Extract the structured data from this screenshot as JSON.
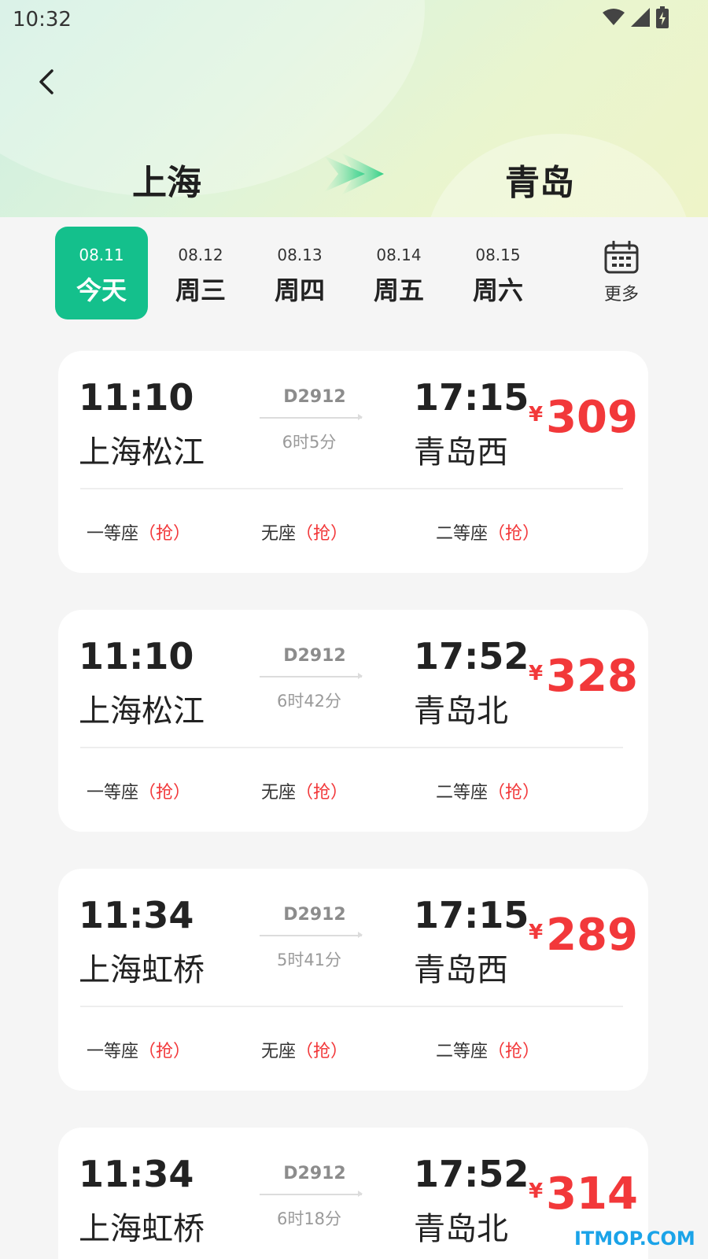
{
  "status_bar": {
    "time": "10:32"
  },
  "route": {
    "from": "上海",
    "to": "青岛"
  },
  "date_tabs": [
    {
      "date": "08.11",
      "weekday": "今天",
      "active": true
    },
    {
      "date": "08.12",
      "weekday": "周三",
      "active": false
    },
    {
      "date": "08.13",
      "weekday": "周四",
      "active": false
    },
    {
      "date": "08.14",
      "weekday": "周五",
      "active": false
    },
    {
      "date": "08.15",
      "weekday": "周六",
      "active": false
    }
  ],
  "more_label": "更多",
  "currency": "¥",
  "trains": [
    {
      "dep_time": "11:10",
      "dep_station": "上海松江",
      "train_no": "D2912",
      "duration": "6时5分",
      "arr_time": "17:15",
      "arr_station": "青岛西",
      "price": "309",
      "seats": [
        {
          "name": "一等座",
          "status": "（抢）"
        },
        {
          "name": "无座",
          "status": "（抢）"
        },
        {
          "name": "二等座",
          "status": "（抢）"
        }
      ]
    },
    {
      "dep_time": "11:10",
      "dep_station": "上海松江",
      "train_no": "D2912",
      "duration": "6时42分",
      "arr_time": "17:52",
      "arr_station": "青岛北",
      "price": "328",
      "seats": [
        {
          "name": "一等座",
          "status": "（抢）"
        },
        {
          "name": "无座",
          "status": "（抢）"
        },
        {
          "name": "二等座",
          "status": "（抢）"
        }
      ]
    },
    {
      "dep_time": "11:34",
      "dep_station": "上海虹桥",
      "train_no": "D2912",
      "duration": "5时41分",
      "arr_time": "17:15",
      "arr_station": "青岛西",
      "price": "289",
      "seats": [
        {
          "name": "一等座",
          "status": "（抢）"
        },
        {
          "name": "无座",
          "status": "（抢）"
        },
        {
          "name": "二等座",
          "status": "（抢）"
        }
      ]
    },
    {
      "dep_time": "11:34",
      "dep_station": "上海虹桥",
      "train_no": "D2912",
      "duration": "6时18分",
      "arr_time": "17:52",
      "arr_station": "青岛北",
      "price": "314",
      "seats": []
    }
  ],
  "watermark": "ITMOP.COM",
  "colors": {
    "accent": "#14c08c",
    "price": "#f2383a"
  }
}
